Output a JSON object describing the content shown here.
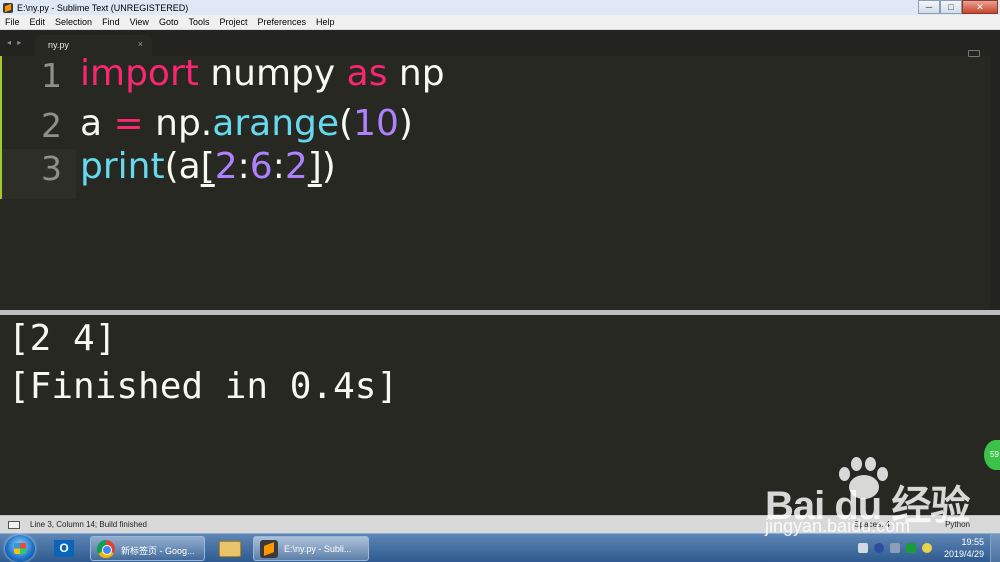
{
  "window": {
    "title": "E:\\ny.py - Sublime Text (UNREGISTERED)",
    "controls": {
      "minimize": "─",
      "maximize": "□",
      "close": "✕"
    }
  },
  "menu": [
    "File",
    "Edit",
    "Selection",
    "Find",
    "View",
    "Goto",
    "Tools",
    "Project",
    "Preferences",
    "Help"
  ],
  "tabs": {
    "nav_arrows": "◂ ▸",
    "active": {
      "label": "ny.py",
      "close": "×"
    }
  },
  "editor": {
    "line_numbers": [
      "1",
      "2",
      "3"
    ],
    "lines": [
      {
        "import": "import",
        "module": "numpy",
        "as": "as",
        "alias": "np"
      },
      {
        "var": "a",
        "op": "=",
        "obj": "np.",
        "func": "arange",
        "open": "(",
        "arg": "10",
        "close": ")"
      },
      {
        "func": "print",
        "open": "(",
        "var": "a",
        "bopen": "[",
        "n1": "2",
        "c1": ":",
        "n2": "6",
        "c2": ":",
        "n3": "2",
        "bclose": "]",
        "close": ")"
      }
    ],
    "active_line": 3
  },
  "output": {
    "lines": [
      "[2 4]",
      "[Finished in 0.4s]"
    ]
  },
  "status": {
    "text": "Line 3, Column 14; Build finished",
    "spaces": "Spaces: 4",
    "syntax": "Python"
  },
  "taskbar": {
    "tasks": [
      {
        "label": "新标签页 - Goog...",
        "icon": "chrome-icon"
      },
      {
        "label": "E:\\ny.py - Subli...",
        "icon": "sublime-icon"
      }
    ],
    "clock": {
      "time": "19:55",
      "date": "2019/4/29"
    }
  },
  "watermark": {
    "logo": "Bai du 经验",
    "url": "jingyan.baidu.com"
  },
  "side_badge": "59",
  "colors": {
    "background": "#272822",
    "keyword": "#f92672",
    "function": "#66d9ef",
    "number": "#ae81ff",
    "text": "#f8f8f2",
    "gutter_marker": "#a6c631"
  }
}
